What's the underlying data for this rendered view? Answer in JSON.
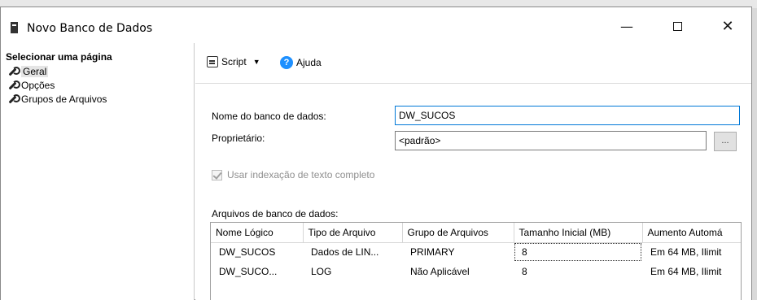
{
  "window": {
    "title": "Novo Banco de Dados",
    "minimize": "—",
    "close": "✕"
  },
  "sidebar": {
    "header": "Selecionar uma página",
    "items": [
      {
        "label": "Geral",
        "icon": "wrench-icon",
        "selected": true
      },
      {
        "label": "Opções",
        "icon": "wrench-icon",
        "selected": false
      },
      {
        "label": "Grupos de Arquivos",
        "icon": "wrench-icon",
        "selected": false
      }
    ]
  },
  "toolbar": {
    "script_label": "Script",
    "help_label": "Ajuda"
  },
  "form": {
    "db_name_label": "Nome do banco de dados:",
    "db_name_value": "DW_SUCOS",
    "owner_label": "Proprietário:",
    "owner_value": "<padrão>",
    "browse_label": "...",
    "fulltext_label": "Usar indexação de texto completo",
    "files_label": "Arquivos de banco de dados:"
  },
  "files_table": {
    "columns": [
      "Nome Lógico",
      "Tipo de Arquivo",
      "Grupo de Arquivos",
      "Tamanho Inicial (MB)",
      "Aumento Automá"
    ],
    "rows": [
      [
        "DW_SUCOS",
        "Dados de LIN...",
        "PRIMARY",
        "8",
        "Em 64 MB, Ilimit"
      ],
      [
        "DW_SUCO...",
        "LOG",
        "Não Aplicável",
        "8",
        "Em 64 MB, Ilimit"
      ]
    ]
  },
  "colors": {
    "focus_border": "#0078d7",
    "help_icon": "#1e90ff"
  }
}
